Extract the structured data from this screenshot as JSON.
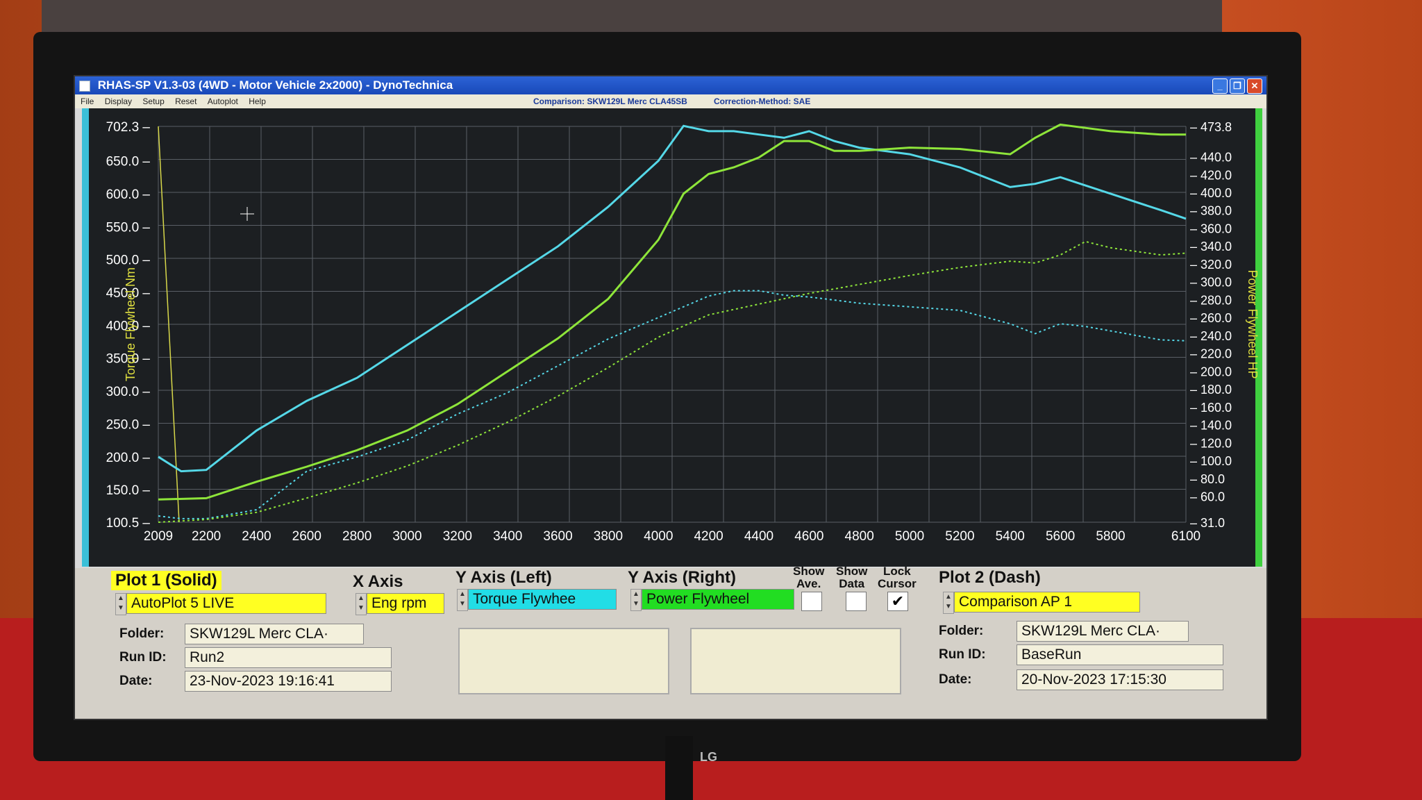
{
  "window": {
    "title": "RHAS-SP V1.3-03  (4WD - Motor Vehicle 2x2000) - DynoTechnica",
    "min_label": "_",
    "max_label": "❐",
    "close_label": "✕"
  },
  "menu": {
    "items": [
      "File",
      "Display",
      "Setup",
      "Reset",
      "Autoplot",
      "Help"
    ],
    "comparison": "Comparison: SKW129L Merc CLA45SB",
    "correction": "Correction-Method: SAE"
  },
  "chart_data": {
    "type": "line",
    "title": "",
    "xlabel": "",
    "ylabel": "Torque Flywheel Nm",
    "y2label": "Power Flywheel HP",
    "xlim": [
      2009,
      6100
    ],
    "ylim": [
      100.5,
      702.3
    ],
    "y2lim": [
      31.0,
      473.8
    ],
    "x_ticks": [
      "2009",
      "2200",
      "2400",
      "2600",
      "2800",
      "3000",
      "3200",
      "3400",
      "3600",
      "3800",
      "4000",
      "4200",
      "4400",
      "4600",
      "4800",
      "5000",
      "5200",
      "5400",
      "5600",
      "5800",
      "6100"
    ],
    "y_ticks": [
      "702.3",
      "650.0",
      "600.0",
      "550.0",
      "500.0",
      "450.0",
      "400.0",
      "350.0",
      "300.0",
      "250.0",
      "200.0",
      "150.0",
      "100.5"
    ],
    "y2_ticks": [
      "473.8",
      "440.0",
      "420.0",
      "400.0",
      "380.0",
      "360.0",
      "340.0",
      "320.0",
      "300.0",
      "280.0",
      "260.0",
      "240.0",
      "220.0",
      "200.0",
      "180.0",
      "160.0",
      "140.0",
      "120.0",
      "100.0",
      "80.0",
      "60.0",
      "31.0"
    ],
    "grid": true,
    "series": [
      {
        "axis": "left",
        "color": "#55d8e8",
        "dash": false,
        "x": [
          2009,
          2100,
          2200,
          2400,
          2600,
          2800,
          3000,
          3200,
          3400,
          3600,
          3800,
          4000,
          4100,
          4200,
          4300,
          4400,
          4500,
          4600,
          4700,
          4800,
          5000,
          5200,
          5400,
          5500,
          5600,
          5800,
          6000,
          6100
        ],
        "y": [
          200,
          178,
          180,
          240,
          285,
          320,
          370,
          420,
          470,
          520,
          580,
          650,
          703,
          695,
          695,
          690,
          685,
          695,
          680,
          670,
          660,
          640,
          610,
          615,
          625,
          600,
          575,
          562
        ]
      },
      {
        "axis": "left",
        "color": "#8ee53a",
        "dash": false,
        "x": [
          2009,
          2200,
          2400,
          2600,
          2800,
          3000,
          3200,
          3400,
          3600,
          3800,
          4000,
          4100,
          4200,
          4300,
          4400,
          4500,
          4600,
          4700,
          4800,
          5000,
          5200,
          5400,
          5500,
          5600,
          5700,
          5800,
          6000,
          6100
        ],
        "y": [
          135,
          137,
          162,
          185,
          210,
          240,
          280,
          330,
          380,
          440,
          530,
          600,
          630,
          640,
          655,
          680,
          680,
          665,
          665,
          670,
          668,
          660,
          685,
          705,
          700,
          695,
          690,
          690
        ]
      },
      {
        "axis": "right",
        "color": "#55d8e8",
        "dash": true,
        "x": [
          2009,
          2100,
          2200,
          2400,
          2600,
          2800,
          3000,
          3200,
          3400,
          3600,
          3800,
          4000,
          4200,
          4300,
          4400,
          4500,
          4600,
          4800,
          5000,
          5200,
          5400,
          5500,
          5600,
          5700,
          5800,
          6000,
          6100
        ],
        "y": [
          38,
          35,
          35,
          45,
          88,
          104,
          123,
          152,
          176,
          206,
          236,
          260,
          284,
          290,
          290,
          285,
          283,
          276,
          272,
          268,
          253,
          242,
          253,
          250,
          245,
          235,
          234
        ]
      },
      {
        "axis": "right",
        "color": "#8ee53a",
        "dash": true,
        "x": [
          2009,
          2200,
          2400,
          2600,
          2800,
          3000,
          3200,
          3400,
          3600,
          3800,
          4000,
          4200,
          4400,
          4600,
          4800,
          5000,
          5200,
          5400,
          5500,
          5600,
          5700,
          5800,
          6000,
          6100
        ],
        "y": [
          31,
          34,
          42,
          58,
          75,
          94,
          117,
          143,
          172,
          204,
          238,
          263,
          275,
          287,
          297,
          307,
          316,
          323,
          321,
          330,
          345,
          338,
          330,
          332
        ]
      }
    ]
  },
  "controls": {
    "plot1": {
      "header": "Plot 1 (Solid)",
      "selection": "AutoPlot 5 LIVE",
      "folder_label": "Folder:",
      "folder": "SKW129L Merc CLA·",
      "run_label": "Run ID:",
      "run": "Run2",
      "date_label": "Date:",
      "date": "23-Nov-2023  19:16:41"
    },
    "x_axis": {
      "header": "X Axis",
      "value": "Eng rpm"
    },
    "y_left": {
      "header": "Y Axis (Left)",
      "value": "Torque Flywhee"
    },
    "y_right": {
      "header": "Y Axis (Right)",
      "value": "Power Flywheel"
    },
    "show_ave": {
      "label1": "Show",
      "label2": "Ave.",
      "checked_mark": ""
    },
    "show_data": {
      "label1": "Show",
      "label2": "Data",
      "checked_mark": ""
    },
    "lock_cursor": {
      "label1": "Lock",
      "label2": "Cursor",
      "checked_mark": "✔"
    },
    "plot2": {
      "header": "Plot 2 (Dash)",
      "selection": "Comparison AP 1",
      "folder_label": "Folder:",
      "folder": "SKW129L Merc CLA·",
      "run_label": "Run ID:",
      "run": "BaseRun",
      "date_label": "Date:",
      "date": "20-Nov-2023  17:15:30"
    }
  },
  "monitor": {
    "brand": "LG"
  }
}
